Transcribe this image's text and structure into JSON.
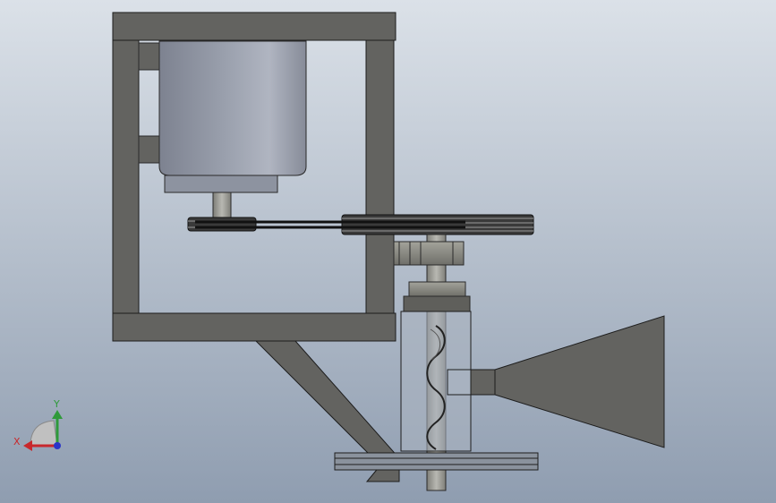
{
  "viewport": {
    "background_top": "#dbe1e8",
    "background_bottom": "#8f9db0"
  },
  "colors": {
    "frame": "#636360",
    "frame_edge": "#1c1c1c",
    "motor_body": "#8a8f9c",
    "motor_highlight": "#a7acb8",
    "hopper": "#636360",
    "belt": "#1e1e1e",
    "glass": "#a9b3c0",
    "gear": "#8c8c84",
    "shaft": "#a3a39d"
  },
  "triad": {
    "x_label": "X",
    "y_label": "Y",
    "x_color": "#c8282c",
    "y_color": "#2f9a3a",
    "z_color": "#2a35c8"
  }
}
